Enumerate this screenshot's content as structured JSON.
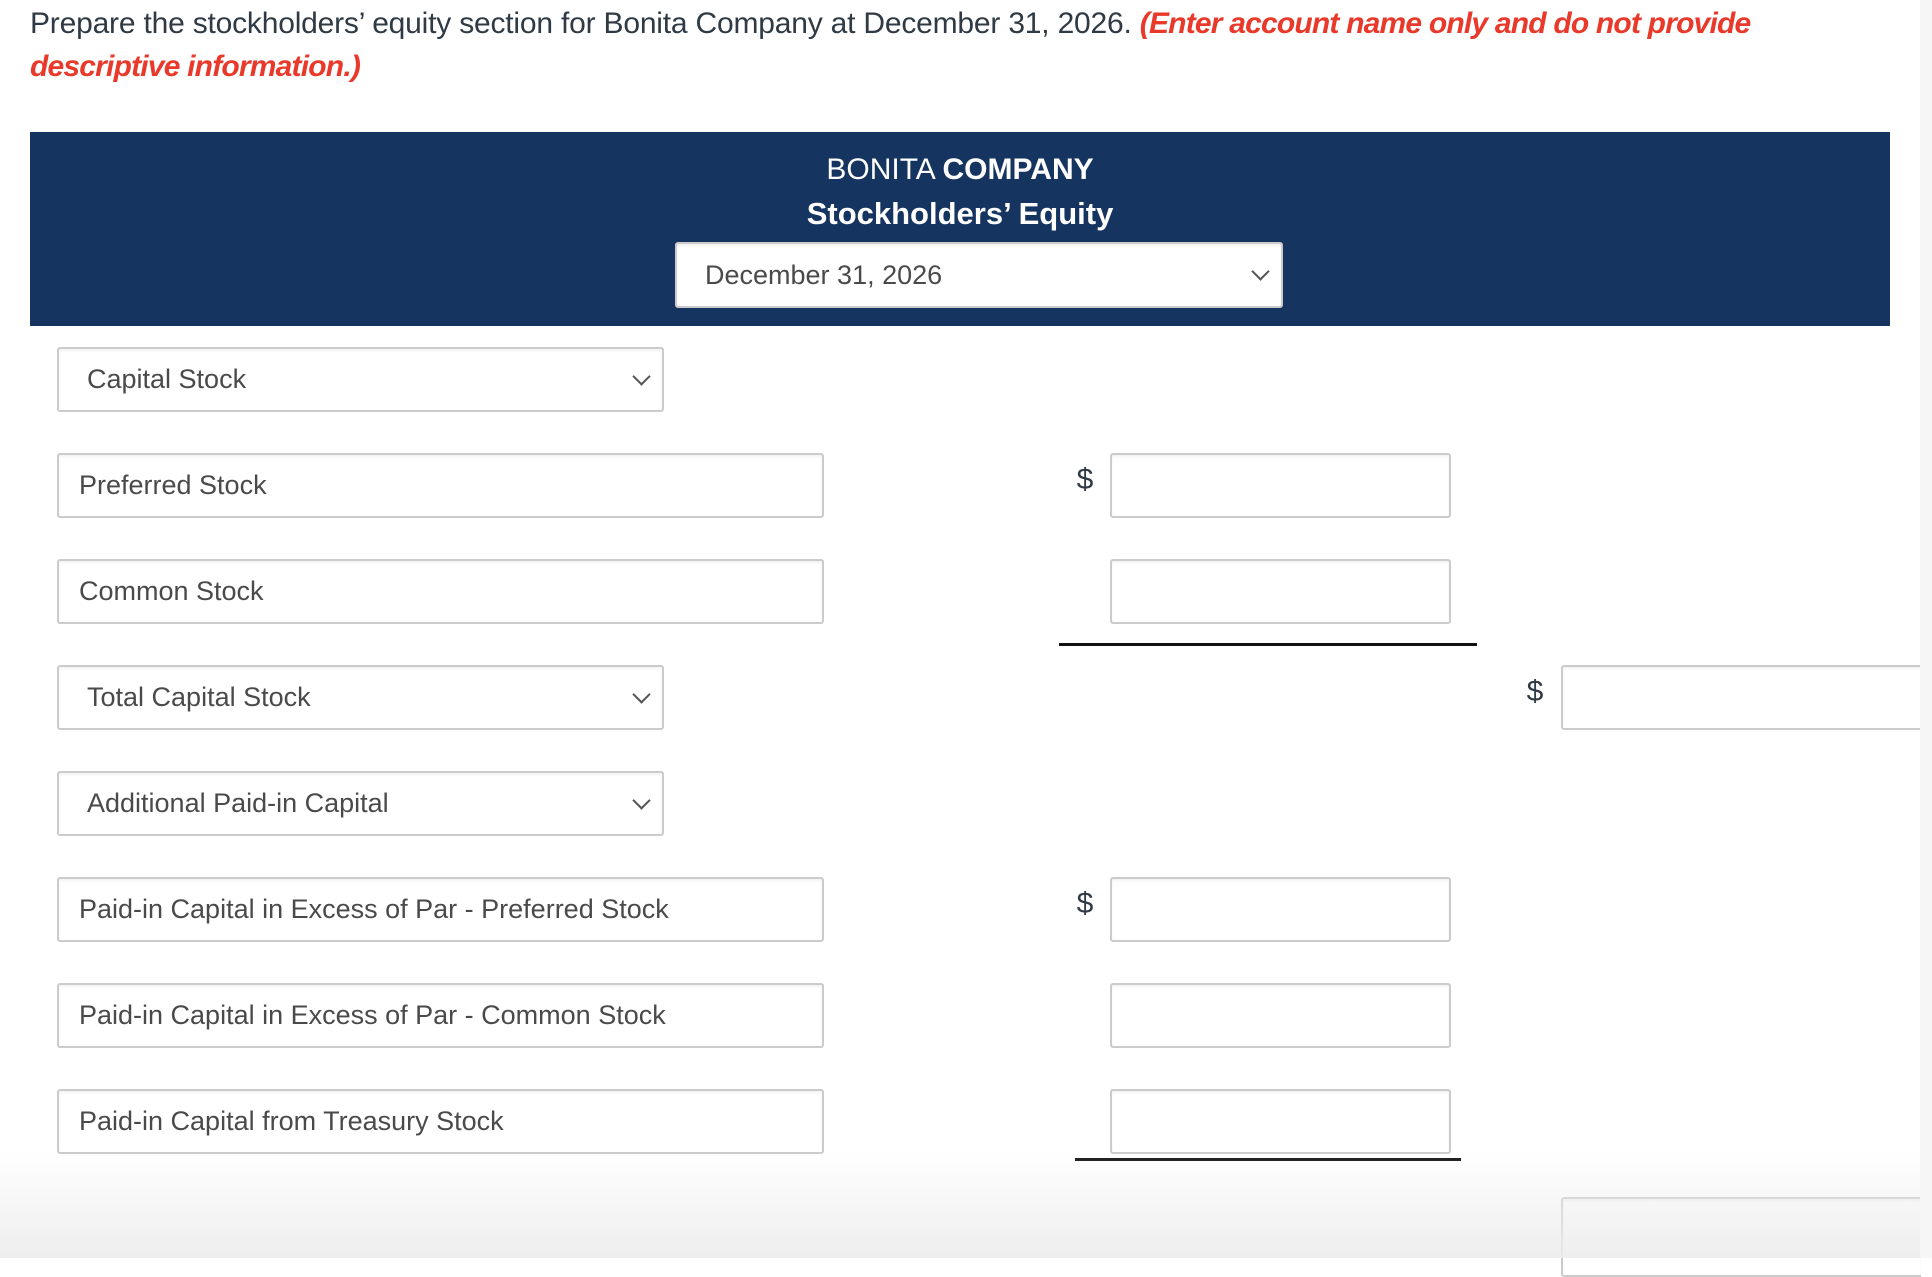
{
  "instructions": {
    "text": "Prepare the stockholders’ equity section for Bonita Company at December 31, 2026.",
    "note": "(Enter account name only and do not provide descriptive information.)"
  },
  "header": {
    "company_plain": "BONITA",
    "company_bold": "COMPANY",
    "statement": "Stockholders’ Equity",
    "date_select": {
      "value": "December 31, 2026"
    }
  },
  "rows": [
    {
      "type": "select",
      "label": "Capital Stock"
    },
    {
      "type": "text",
      "label": "Preferred Stock",
      "dollar1": "$",
      "amount1": ""
    },
    {
      "type": "text",
      "label": "Common Stock",
      "amount1": ""
    },
    {
      "type": "select",
      "label": "Total Capital Stock",
      "dollar2": "$",
      "amount2": ""
    },
    {
      "type": "select",
      "label": "Additional Paid-in Capital"
    },
    {
      "type": "text",
      "label": "Paid-in Capital in Excess of Par - Preferred Stock",
      "dollar1": "$",
      "amount1": ""
    },
    {
      "type": "text",
      "label": "Paid-in Capital in Excess of Par - Common Stock",
      "amount1": ""
    },
    {
      "type": "text",
      "label": "Paid-in Capital from Treasury Stock",
      "amount1": ""
    }
  ],
  "bottom_total": {
    "amount2": ""
  },
  "colors": {
    "header_bg": "#163460",
    "note_red": "#e8392a",
    "text": "#2f3a44"
  }
}
